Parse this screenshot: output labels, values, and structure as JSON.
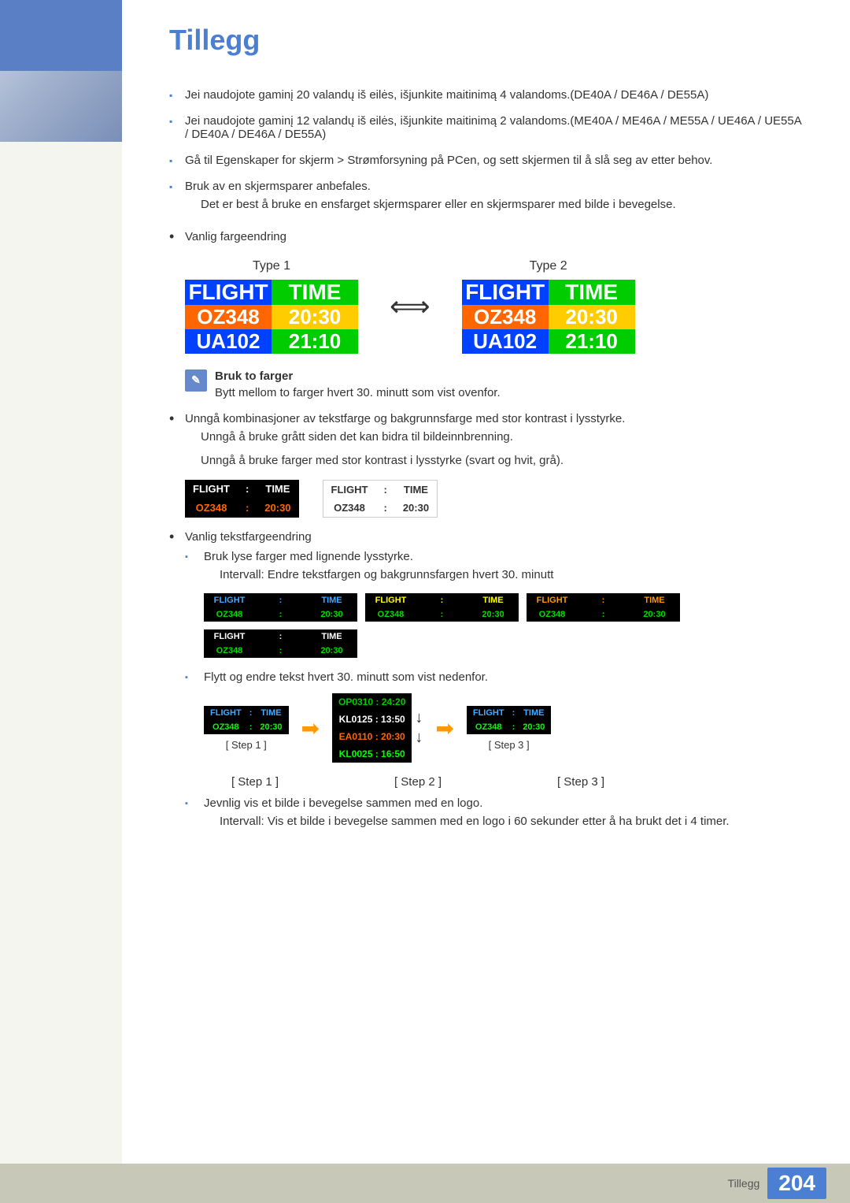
{
  "page": {
    "title": "Tillegg",
    "footer_label": "Tillegg",
    "footer_page": "204"
  },
  "bullet_items": [
    {
      "text": "Jei naudojote gaminį 20 valandų iš eilės, išjunkite maitinimą 4 valandoms.(DE40A / DE46A / DE55A)"
    },
    {
      "text": "Jei naudojote gaminį 12 valandų iš eilės, išjunkite maitinimą 2 valandoms.(ME40A / ME46A / ME55A / UE46A / UE55A / DE40A / DE46A / DE55A)"
    },
    {
      "text": "Gå til Egenskaper for skjerm > Strømforsyning på PCen, og sett skjermen til å slå seg av etter behov."
    },
    {
      "text": "Bruk av en skjermsparer anbefales.",
      "sub": "Det er best å bruke en ensfarget skjermsparer eller en skjermsparer med bilde i bevegelse."
    }
  ],
  "vanlig_fargeendring": "Vanlig fargeendring",
  "type1_label": "Type 1",
  "type2_label": "Type 2",
  "flight_label": "FLIGHT",
  "time_label": "TIME",
  "oz348": "OZ348",
  "t2030": "20:30",
  "ua102": "UA102",
  "t2110": "21:10",
  "note_label": "Bruk to farger",
  "note_desc": "Bytt mellom to farger hvert 30. minutt som vist ovenfor.",
  "vanlig_tekst": "Unngå kombinasjoner av tekstfarge og bakgrunnsfarge med stor kontrast i lysstyrke.",
  "unnga1": "Unngå å bruke grått siden det kan bidra til bildeinnbrenning.",
  "unnga2": "Unngå å bruke farger med stor kontrast i lysstyrke (svart og hvit, grå).",
  "vanlig_tekst2": "Vanlig tekstfargeendring",
  "bruk_lyse": "Bruk lyse farger med lignende lysstyrke.",
  "intervall1": "Intervall: Endre tekstfargen og bakgrunnsfargen hvert 30. minutt",
  "flytt_tekst": "Flytt og endre tekst hvert 30. minutt som vist nedenfor.",
  "step1_label": "[ Step 1 ]",
  "step2_label": "[ Step 2 ]",
  "step3_label": "[ Step 3 ]",
  "step2_rows": [
    "OP0310 :  24:20",
    "KL0125 :  13:50",
    "EA0110 :  20:30",
    "KL0025 :  16:50"
  ],
  "jevnlig": "Jevnlig vis et bilde i bevegelse sammen med en logo.",
  "intervall2": "Intervall: Vis et bilde i bevegelse sammen med en logo i 60 sekunder etter å ha brukt det i 4 timer.",
  "color_variants": [
    {
      "flight_color": "#44aaff",
      "data_color": "#00dd00",
      "bg": "#000000"
    },
    {
      "flight_color": "#ffff00",
      "data_color": "#00dd00",
      "bg": "#000000"
    },
    {
      "flight_color": "#ff9900",
      "data_color": "#00dd00",
      "bg": "#000000"
    },
    {
      "flight_color": "#ffffff",
      "data_color": "#00dd00",
      "bg": "#000000"
    }
  ]
}
